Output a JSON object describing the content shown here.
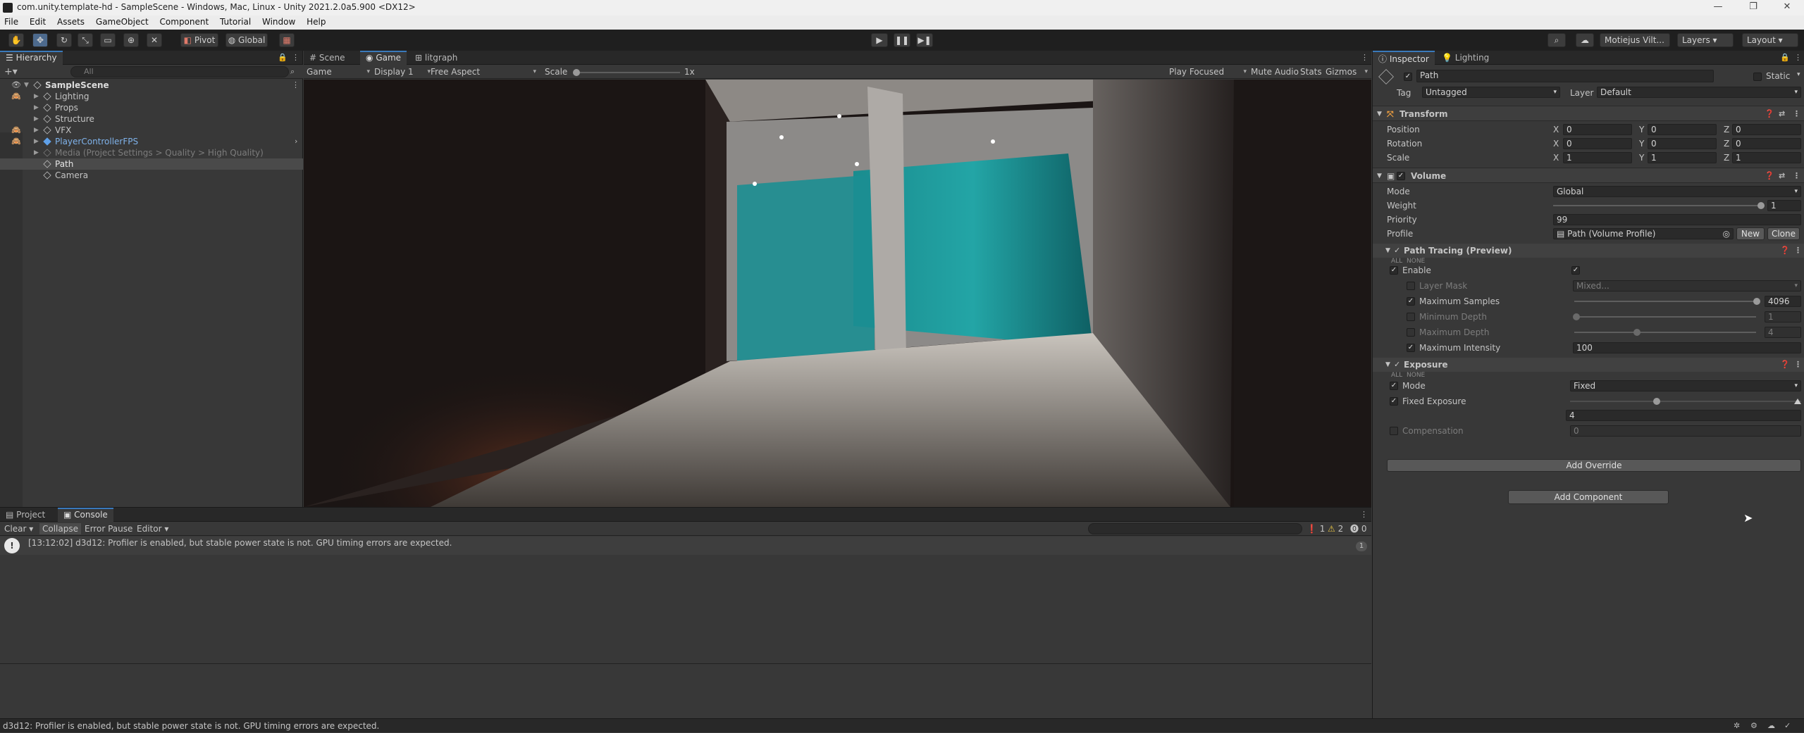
{
  "window": {
    "title": "com.unity.template-hd - SampleScene - Windows, Mac, Linux - Unity 2021.2.0a5.900 <DX12>"
  },
  "menu": [
    "File",
    "Edit",
    "Assets",
    "GameObject",
    "Component",
    "Tutorial",
    "Window",
    "Help"
  ],
  "toolbar": {
    "pivot": "Pivot",
    "global": "Global",
    "account": "Motiejus Vilt...",
    "layers": "Layers",
    "layout": "Layout"
  },
  "hierarchy": {
    "tab": "Hierarchy",
    "search_placeholder": "All",
    "scene": "SampleScene",
    "items": [
      {
        "label": "Lighting"
      },
      {
        "label": "Props"
      },
      {
        "label": "Structure"
      },
      {
        "label": "VFX"
      },
      {
        "label": "PlayerControllerFPS"
      },
      {
        "label": "Media (Project Settings > Quality > High Quality)"
      },
      {
        "label": "Path"
      },
      {
        "label": "Camera"
      }
    ]
  },
  "scene_view": {
    "tabs": [
      "Scene",
      "Game",
      "litgraph"
    ],
    "display_mode": "Game",
    "display": "Display 1",
    "aspect": "Free Aspect",
    "scale_label": "Scale",
    "scale_value": "1x",
    "play_focused": "Play Focused",
    "mute_audio": "Mute Audio",
    "stats": "Stats",
    "gizmos": "Gizmos"
  },
  "console": {
    "tabs": [
      "Project",
      "Console"
    ],
    "clear": "Clear",
    "collapse": "Collapse",
    "error_pause": "Error Pause",
    "editor": "Editor",
    "counts": {
      "info": "1",
      "warn": "2",
      "error": "0"
    },
    "message": "[13:12:02] d3d12: Profiler is enabled, but stable power state is not. GPU timing errors are expected.",
    "message_count": "1"
  },
  "inspector": {
    "tabs": [
      "Inspector",
      "Lighting"
    ],
    "object_name": "Path",
    "static_label": "Static",
    "tag_label": "Tag",
    "tag_value": "Untagged",
    "layer_label": "Layer",
    "layer_value": "Default",
    "transform": {
      "title": "Transform",
      "position_label": "Position",
      "rotation_label": "Rotation",
      "scale_label": "Scale",
      "position": {
        "x": "0",
        "y": "0",
        "z": "0"
      },
      "rotation": {
        "x": "0",
        "y": "0",
        "z": "0"
      },
      "scale": {
        "x": "1",
        "y": "1",
        "z": "1"
      }
    },
    "volume": {
      "title": "Volume",
      "mode_label": "Mode",
      "mode_value": "Global",
      "weight_label": "Weight",
      "weight_value": "1",
      "priority_label": "Priority",
      "priority_value": "99",
      "profile_label": "Profile",
      "profile_value": "Path (Volume Profile)",
      "new_btn": "New",
      "clone_btn": "Clone"
    },
    "path_tracing": {
      "title": "Path Tracing (Preview)",
      "all": "ALL",
      "none": "NONE",
      "enable_label": "Enable",
      "layer_mask_label": "Layer Mask",
      "layer_mask_value": "Mixed...",
      "max_samples_label": "Maximum Samples",
      "max_samples_value": "4096",
      "min_depth_label": "Minimum Depth",
      "min_depth_value": "1",
      "max_depth_label": "Maximum Depth",
      "max_depth_value": "4",
      "max_intensity_label": "Maximum Intensity",
      "max_intensity_value": "100"
    },
    "exposure": {
      "title": "Exposure",
      "all": "ALL",
      "none": "NONE",
      "mode_label": "Mode",
      "mode_value": "Fixed",
      "fixed_label": "Fixed Exposure",
      "fixed_value": "4",
      "compensation_label": "Compensation",
      "compensation_value": "0"
    },
    "add_override": "Add Override",
    "add_component": "Add Component"
  },
  "status": {
    "message": "d3d12: Profiler is enabled, but stable power state is not. GPU timing errors are expected."
  },
  "colors": {
    "accent": "#3a79bb",
    "panel": "#383838",
    "toolbar": "#1f1f1f"
  }
}
